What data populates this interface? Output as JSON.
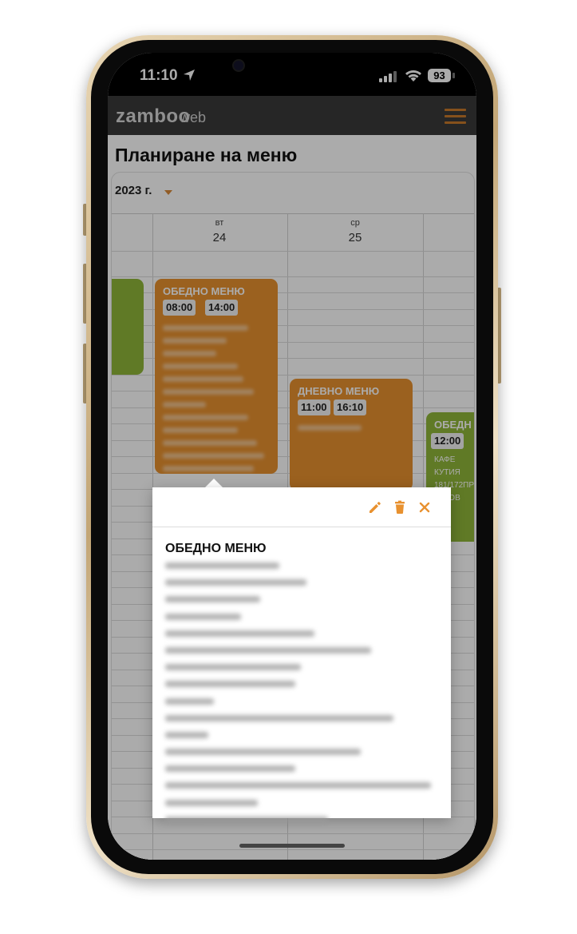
{
  "status_bar": {
    "time": "11:10",
    "battery": "93"
  },
  "header": {
    "brand": "zamboo",
    "brand_suffix": "web"
  },
  "page": {
    "title": "Планиране на меню"
  },
  "calendar": {
    "year": "2023 г.",
    "days": [
      {
        "dow": "вт",
        "num": "24"
      },
      {
        "dow": "ср",
        "num": "25"
      }
    ],
    "events": [
      {
        "title": "ОБЕДНО МЕНЮ",
        "times": [
          "08:00",
          "14:00"
        ],
        "color": "#e8912f"
      },
      {
        "title": "ДНЕВНО МЕНЮ",
        "times": [
          "11:00",
          "16:10"
        ],
        "color": "#e8912f"
      },
      {
        "title": "ОБЕДН",
        "times": [
          "12:00"
        ],
        "lines": [
          "КАФЕ",
          "КУТИЯ",
          "181/172ПР",
          "ГОТОВ"
        ],
        "color": "#8fb63a"
      }
    ]
  },
  "popup": {
    "title": "ОБЕДНО МЕНЮ",
    "actions": [
      "edit-icon",
      "trash-icon",
      "close-icon"
    ],
    "accent": "#e8912f"
  }
}
